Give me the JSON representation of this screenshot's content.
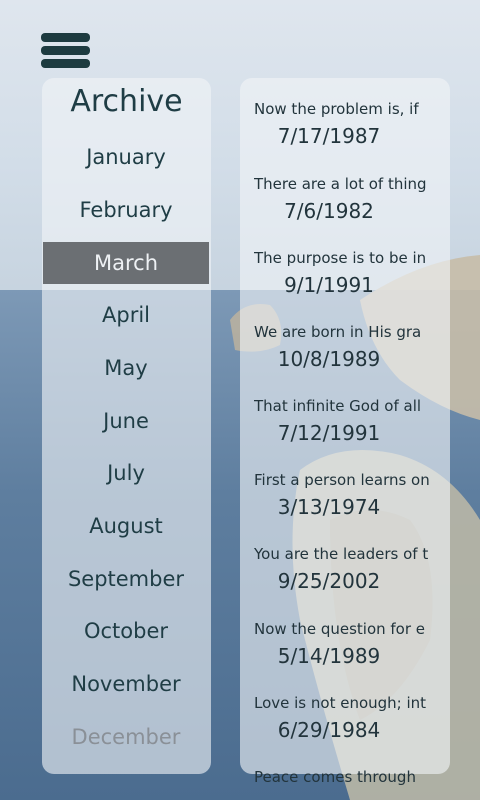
{
  "archive": {
    "title": "Archive",
    "months": [
      "January",
      "February",
      "March",
      "April",
      "May",
      "June",
      "July",
      "August",
      "September",
      "October",
      "November",
      "December"
    ],
    "selected": "March"
  },
  "entries": [
    {
      "snippet": "Now the problem is, if",
      "date": "7/17/1987"
    },
    {
      "snippet": "There are a lot of thing",
      "date": "7/6/1982"
    },
    {
      "snippet": "The purpose is to be in",
      "date": "9/1/1991"
    },
    {
      "snippet": "We are born in His gra",
      "date": "10/8/1989"
    },
    {
      "snippet": "That infinite God of all",
      "date": "7/12/1991"
    },
    {
      "snippet": "First a person learns on",
      "date": "3/13/1974"
    },
    {
      "snippet": "You are the leaders of t",
      "date": "9/25/2002"
    },
    {
      "snippet": "Now the question for e",
      "date": "5/14/1989"
    },
    {
      "snippet": "Love is not enough; int",
      "date": "6/29/1984"
    },
    {
      "snippet": "Peace comes through",
      "date": ""
    }
  ],
  "colors": {
    "selected_bg": "#6b6f73",
    "text": "#1f3d45",
    "menu_icon": "#1d3b40"
  }
}
